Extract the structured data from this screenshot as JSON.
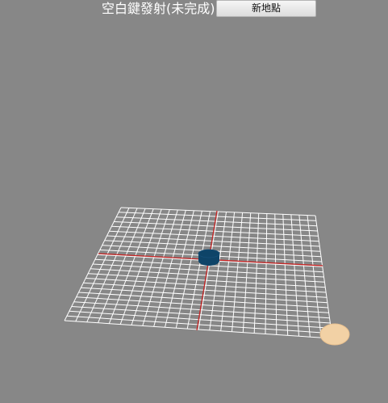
{
  "header": {
    "instruction_text": "空白鍵發射(未完成)",
    "new_point_button_label": "新地點"
  },
  "scene": {
    "background_color": "#878787",
    "grid_color": "#ffffff",
    "axis_color": "#cc2222",
    "player_color": "#0e4468",
    "target_color": "#f2d1a5",
    "grid_divisions": 24
  }
}
